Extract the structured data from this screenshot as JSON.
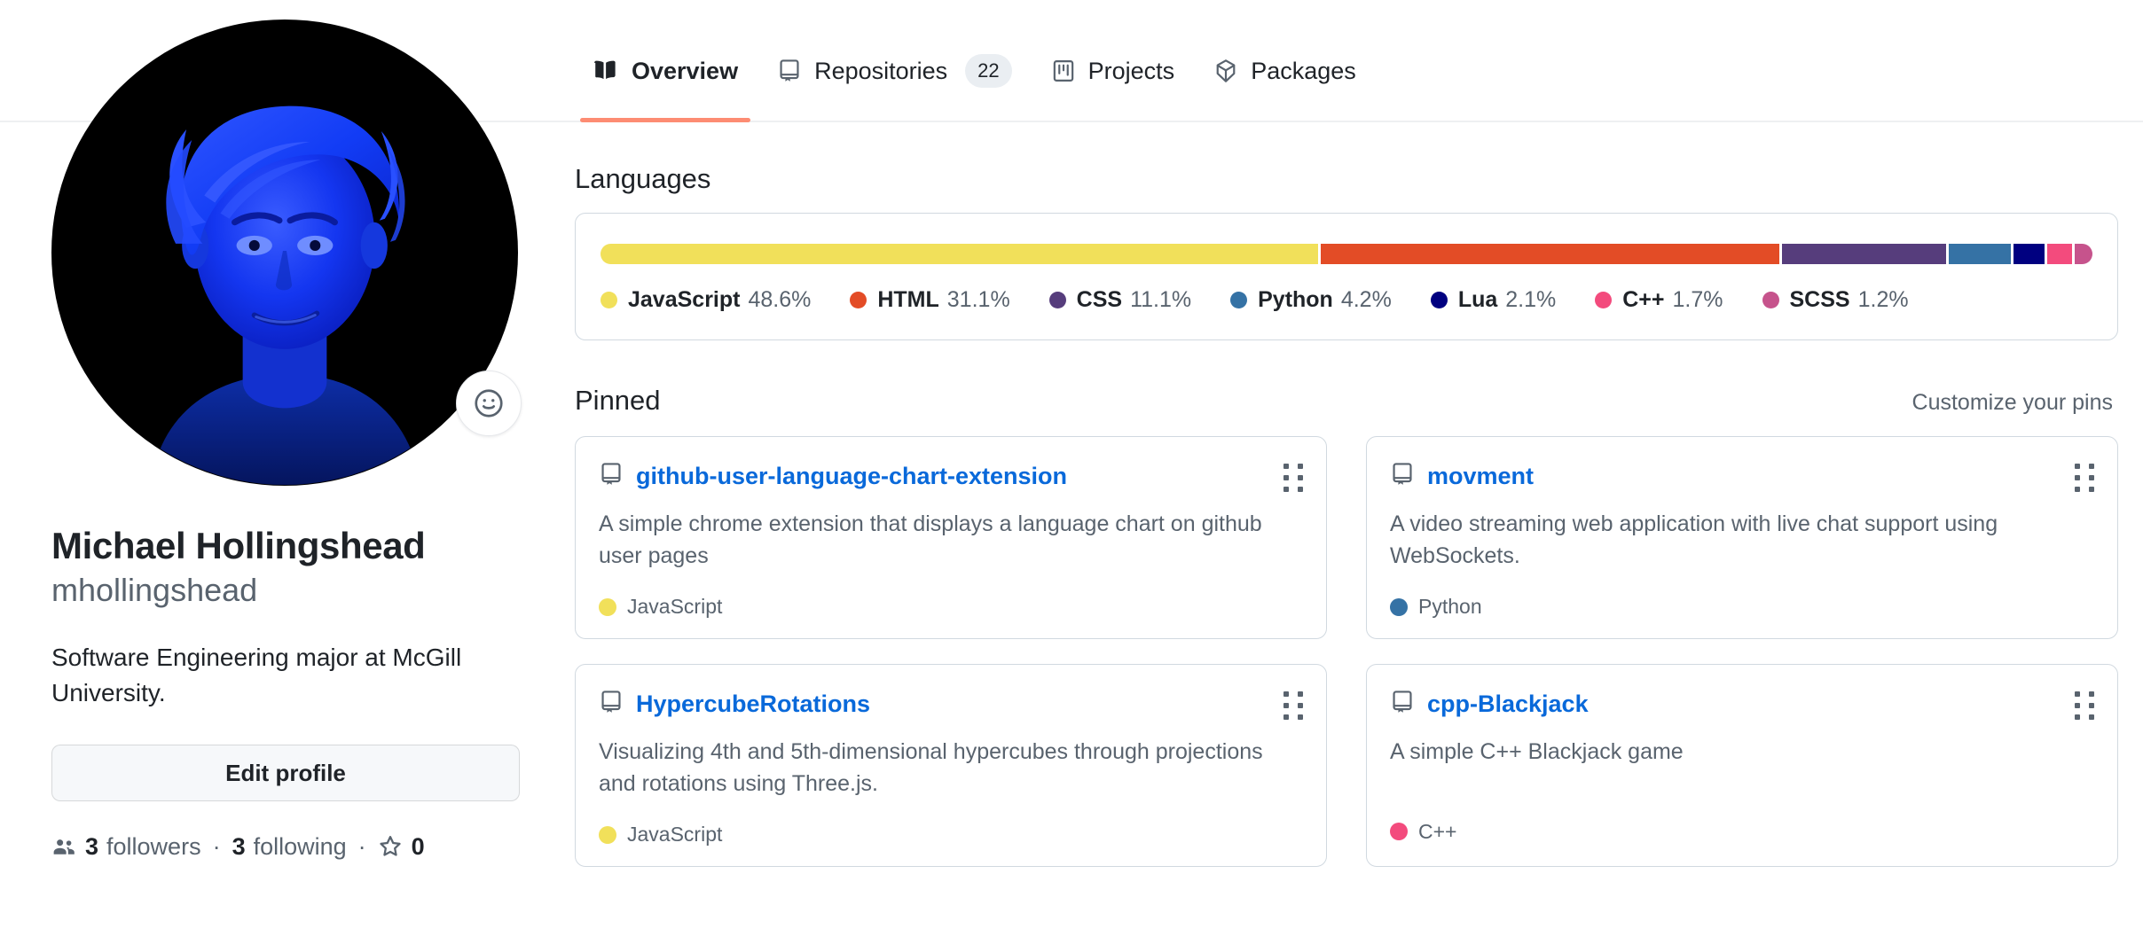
{
  "tabs": [
    {
      "label": "Overview",
      "icon": "book-icon",
      "active": true,
      "count": null
    },
    {
      "label": "Repositories",
      "icon": "repo-icon",
      "active": false,
      "count": "22"
    },
    {
      "label": "Projects",
      "icon": "project-icon",
      "active": false,
      "count": null
    },
    {
      "label": "Packages",
      "icon": "package-icon",
      "active": false,
      "count": null
    }
  ],
  "profile": {
    "avatar_alt": "blue 3d rendered portrait avatar on black background",
    "status_icon": "smiley-icon",
    "full_name": "Michael Hollingshead",
    "login": "mhollingshead",
    "bio": "Software Engineering major at McGill University.",
    "edit_button": "Edit profile",
    "followers_count": "3",
    "followers_label": "followers",
    "following_count": "3",
    "following_label": "following",
    "stars_count": "0",
    "separator": "·"
  },
  "languages_section": {
    "title": "Languages"
  },
  "pinned_section": {
    "title": "Pinned",
    "customize_link": "Customize your pins"
  },
  "chart_data": {
    "type": "bar",
    "title": "Languages",
    "orientation": "horizontal-stacked",
    "unit": "percent",
    "categories": [
      "JavaScript",
      "HTML",
      "CSS",
      "Python",
      "Lua",
      "C++",
      "SCSS"
    ],
    "values": [
      48.6,
      31.1,
      11.1,
      4.2,
      2.1,
      1.7,
      1.2
    ],
    "labels": [
      "48.6%",
      "31.1%",
      "11.1%",
      "4.2%",
      "2.1%",
      "1.7%",
      "1.2%"
    ],
    "colors": [
      "#f1e05a",
      "#e34c26",
      "#563d7c",
      "#3572A5",
      "#000080",
      "#f34b7d",
      "#c6538c"
    ],
    "legend_position": "below",
    "xlabel": "",
    "ylabel": "",
    "grid": false
  },
  "pinned_repos": [
    {
      "name": "github-user-language-chart-extension",
      "description": "A simple chrome extension that displays a language chart on github user pages",
      "language": "JavaScript",
      "language_color": "#f1e05a"
    },
    {
      "name": "movment",
      "description": "A video streaming web application with live chat support using WebSockets.",
      "language": "Python",
      "language_color": "#3572A5"
    },
    {
      "name": "HypercubeRotations",
      "description": "Visualizing 4th and 5th-dimensional hypercubes through projections and rotations using Three.js.",
      "language": "JavaScript",
      "language_color": "#f1e05a"
    },
    {
      "name": "cpp-Blackjack",
      "description": "A simple C++ Blackjack game",
      "language": "C++",
      "language_color": "#f34b7d"
    }
  ],
  "theme": {
    "link_color": "#0969da",
    "active_tab_underline": "#fd8c73",
    "muted_text": "#59636e",
    "border": "#d1d9e0"
  }
}
